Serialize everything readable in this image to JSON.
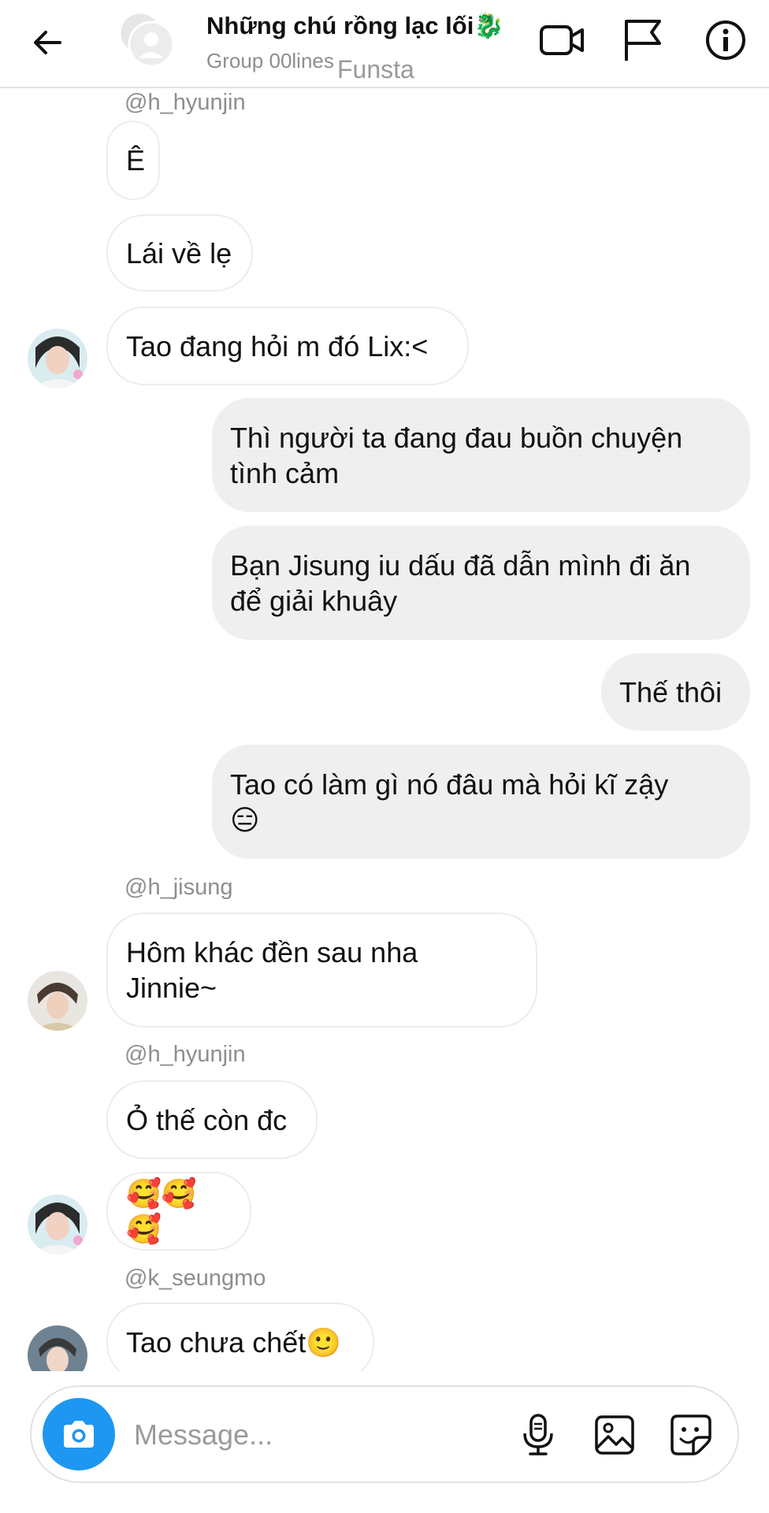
{
  "header": {
    "title": "Những chú rồng lạc lối🐉",
    "subtitle": "Group 00lines",
    "watermark": "Funsta"
  },
  "messages": [
    {
      "sender": "@h_hyunjin",
      "text": "Ê"
    },
    {
      "text": "Lái về lẹ"
    },
    {
      "text": "Tao đang hỏi m đó Lix:<"
    },
    {
      "text_line1": "Thì người ta đang đau buồn chuyện",
      "text_line2": "tình cảm"
    },
    {
      "text_line1": "Bạn Jisung iu dấu đã dẫn mình đi ăn",
      "text_line2": "để giải khuây"
    },
    {
      "text": "Thế thôi"
    },
    {
      "text_line1": "Tao có làm gì nó đâu mà hỏi kĩ zậy",
      "text_line2": "😑"
    },
    {
      "sender": "@h_jisung",
      "text_line1": "Hôm khác đền sau nha",
      "text_line2": "Jinnie~"
    },
    {
      "sender": "@h_hyunjin",
      "text": "Ỏ thế còn đc"
    },
    {
      "text": "🥰🥰🥰"
    },
    {
      "sender": "@k_seungmo",
      "text": "Tao chưa chết🙂"
    }
  ],
  "composer": {
    "placeholder": "Message..."
  },
  "icons": {
    "back": "arrow-left-icon",
    "video": "video-camera-icon",
    "flag": "flag-icon",
    "info": "info-icon",
    "camera": "camera-icon",
    "mic": "microphone-icon",
    "gallery": "image-icon",
    "sticker": "sticker-icon"
  },
  "colors": {
    "accent": "#1d97f1",
    "outgoing_bubble": "#efefef",
    "incoming_border": "#ececec",
    "muted_text": "#8e8e8e"
  }
}
